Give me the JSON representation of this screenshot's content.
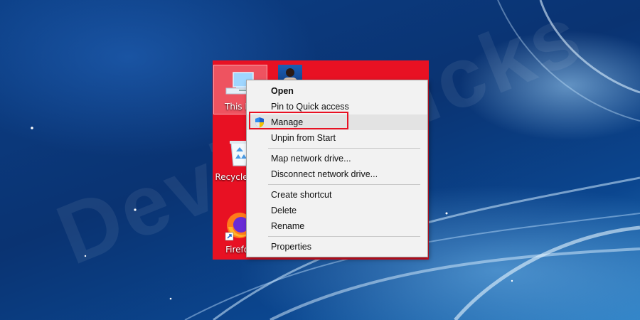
{
  "desktop": {
    "icons": [
      {
        "label": "This PC",
        "icon": "computer-icon"
      },
      {
        "label": "Recycle Bin",
        "icon": "recycle-bin-icon"
      },
      {
        "label": "Firefox",
        "icon": "firefox-icon"
      }
    ]
  },
  "context_menu": {
    "items": [
      {
        "label": "Open",
        "bold": true
      },
      {
        "label": "Pin to Quick access"
      },
      {
        "label": "Manage",
        "icon": "uac-shield-icon",
        "highlighted": true
      },
      {
        "label": "Unpin from Start"
      },
      {
        "label": "Map network drive..."
      },
      {
        "label": "Disconnect network drive..."
      },
      {
        "label": "Create shortcut"
      },
      {
        "label": "Delete"
      },
      {
        "label": "Rename"
      },
      {
        "label": "Properties"
      }
    ]
  },
  "watermark": "DeviceTricks",
  "colors": {
    "accent_red": "#e81123",
    "menu_bg": "#f2f2f2",
    "highlight_border": "#e81123"
  }
}
